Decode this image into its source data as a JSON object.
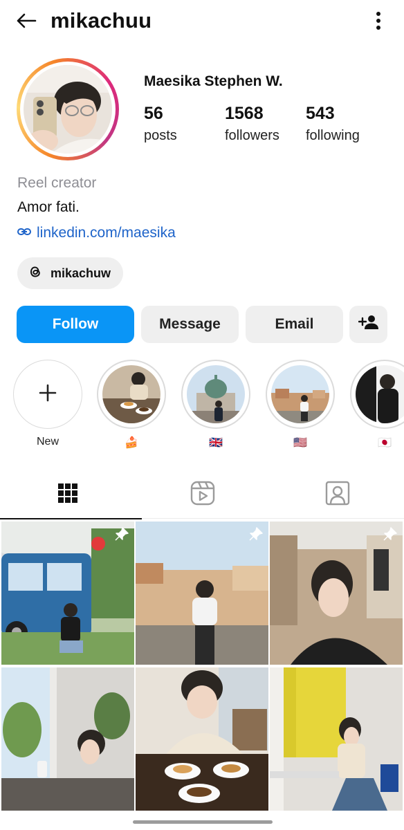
{
  "header": {
    "username": "mikachuu"
  },
  "profile": {
    "full_name": "Maesika Stephen W.",
    "stats": [
      {
        "number": "56",
        "label": "posts"
      },
      {
        "number": "1568",
        "label": "followers"
      },
      {
        "number": "543",
        "label": "following"
      }
    ],
    "category": "Reel creator",
    "bio": "Amor fati.",
    "link": "linkedin.com/maesika",
    "threads_handle": "mikachuw"
  },
  "actions": {
    "follow_label": "Follow",
    "message_label": "Message",
    "email_label": "Email"
  },
  "highlights": [
    {
      "label": "New"
    },
    {
      "label": "🍰"
    },
    {
      "label": "🇬🇧"
    },
    {
      "label": "🇺🇸"
    },
    {
      "label": "🇯🇵"
    }
  ],
  "colors": {
    "follow_button": "#0A95F6",
    "link": "#1D63C9",
    "secondary_button": "#EFEFEF"
  },
  "icons": [
    "back-arrow-icon",
    "more-vertical-icon",
    "link-icon",
    "threads-icon",
    "add-user-icon",
    "plus-icon",
    "grid-icon",
    "reels-icon",
    "tagged-icon",
    "pin-icon"
  ]
}
